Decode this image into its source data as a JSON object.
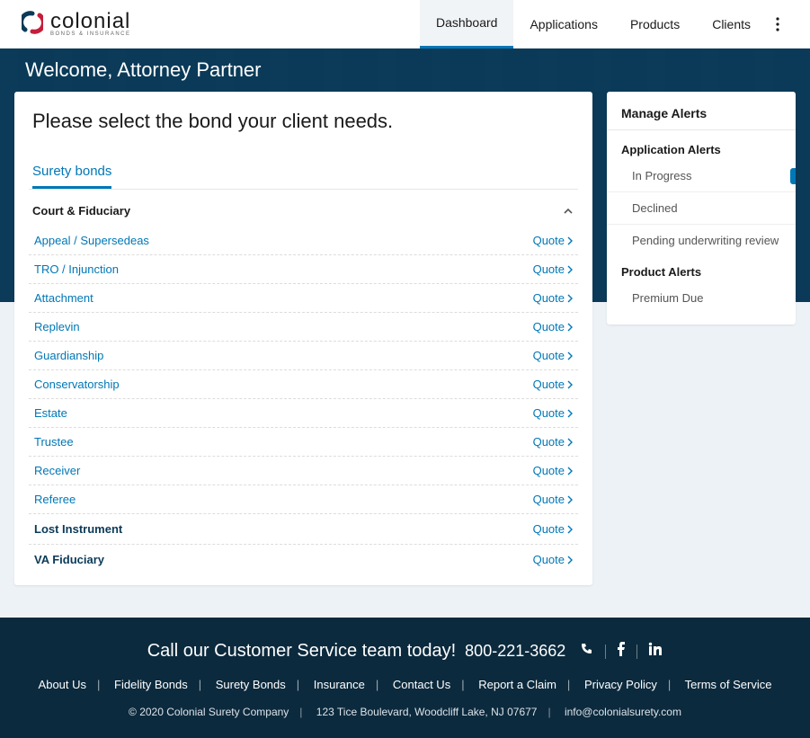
{
  "brand": {
    "name": "colonial",
    "sub": "BONDS & INSURANCE"
  },
  "nav": {
    "items": [
      {
        "label": "Dashboard",
        "active": true
      },
      {
        "label": "Applications",
        "active": false
      },
      {
        "label": "Products",
        "active": false
      },
      {
        "label": "Clients",
        "active": false
      }
    ]
  },
  "hero": {
    "welcome": "Welcome, Attorney Partner"
  },
  "main": {
    "title": "Please select the bond your client needs.",
    "tab_label": "Surety bonds",
    "quote_label": "Quote",
    "categories": {
      "court_fiduciary": {
        "label": "Court & Fiduciary",
        "expanded": true,
        "bonds": [
          "Appeal / Supersedeas",
          "TRO / Injunction",
          "Attachment",
          "Replevin",
          "Guardianship",
          "Conservatorship",
          "Estate",
          "Trustee",
          "Receiver",
          "Referee"
        ]
      },
      "lost_instrument": {
        "label": "Lost Instrument"
      },
      "va_fiduciary": {
        "label": "VA Fiduciary"
      }
    }
  },
  "alerts": {
    "title": "Manage Alerts",
    "application": {
      "title": "Application Alerts",
      "items": [
        "In Progress",
        "Declined",
        "Pending underwriting review"
      ]
    },
    "product": {
      "title": "Product Alerts",
      "items": [
        "Premium Due"
      ]
    }
  },
  "footer": {
    "cta": "Call our Customer Service team today!",
    "phone": "800-221-3662",
    "links": [
      "About Us",
      "Fidelity Bonds",
      "Surety Bonds",
      "Insurance",
      "Contact Us",
      "Report a Claim",
      "Privacy Policy",
      "Terms of Service"
    ],
    "copyright": "© 2020 Colonial Surety Company",
    "address": "123 Tice Boulevard, Woodcliff Lake, NJ 07677",
    "email": "info@colonialsurety.com"
  }
}
